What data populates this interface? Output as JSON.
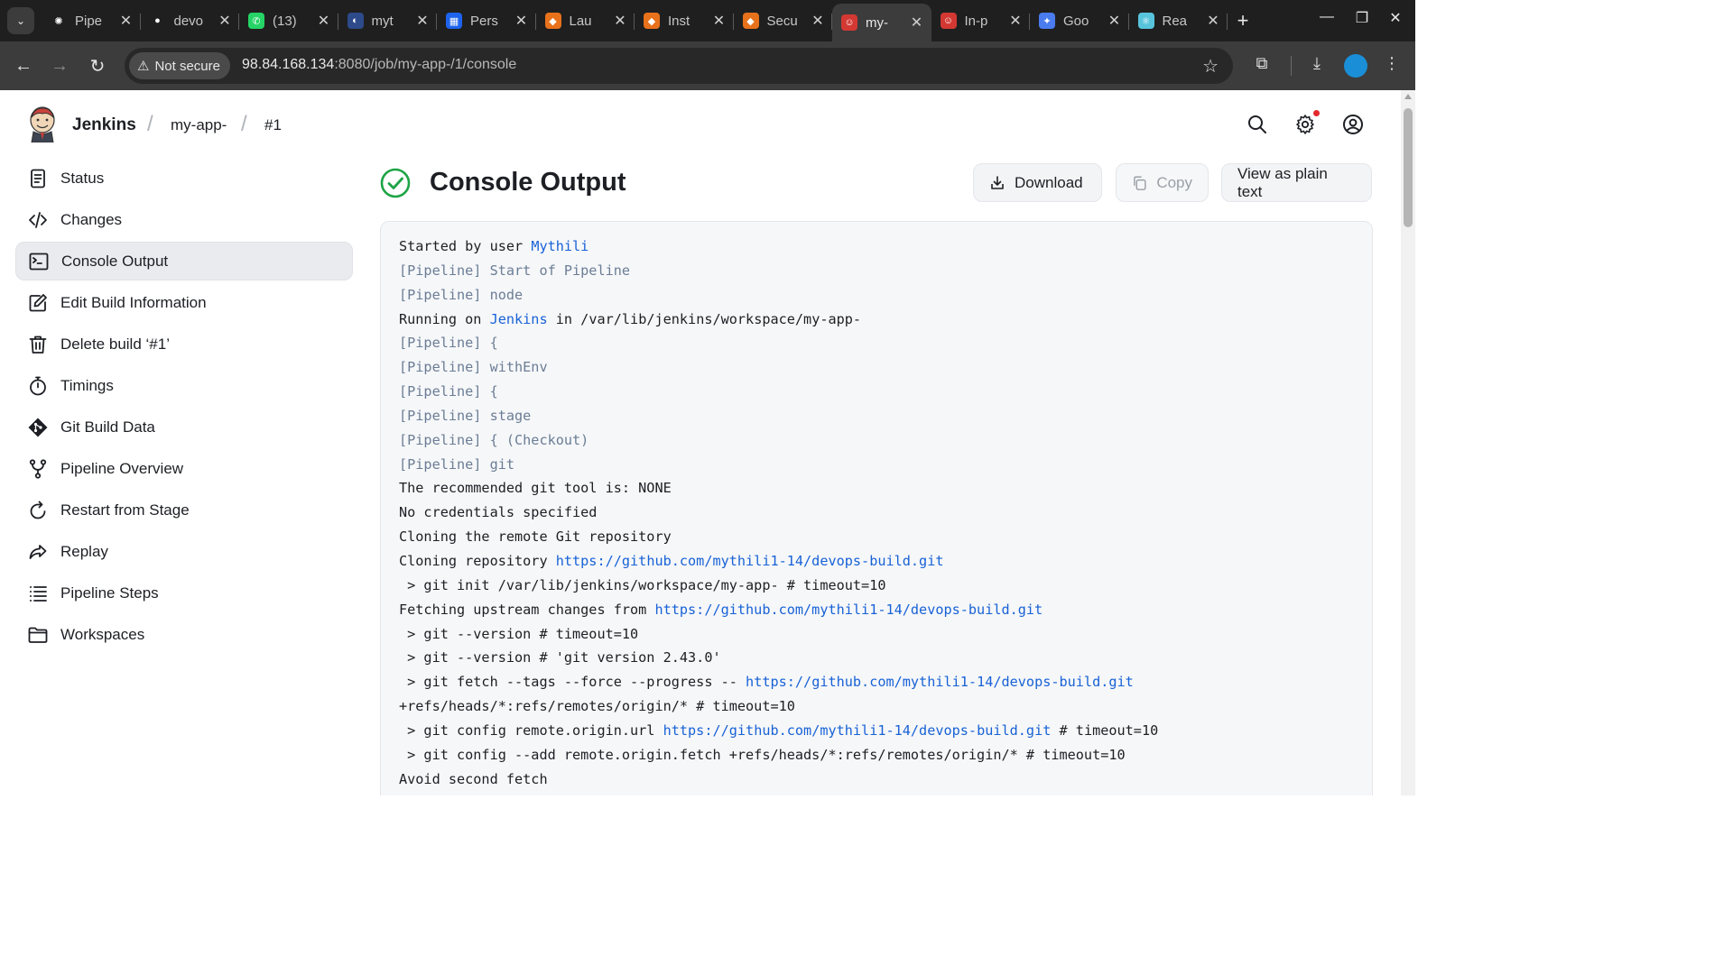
{
  "browser": {
    "tabs": [
      {
        "title": "Pipe",
        "icon": "openai-icon",
        "color": "#1f1f1f"
      },
      {
        "title": "devo",
        "icon": "github-icon",
        "color": "#1f1f1f"
      },
      {
        "title": "(13)",
        "icon": "whatsapp-icon",
        "color": "#25d366"
      },
      {
        "title": "myt",
        "icon": "app-icon",
        "color": "#2d4a8a"
      },
      {
        "title": "Pers",
        "icon": "docker-icon",
        "color": "#1d63ed"
      },
      {
        "title": "Lau",
        "icon": "aws-icon",
        "color": "#e8711b"
      },
      {
        "title": "Inst",
        "icon": "aws-icon",
        "color": "#e8711b"
      },
      {
        "title": "Secu",
        "icon": "aws-icon",
        "color": "#e8711b"
      },
      {
        "title": "my-",
        "icon": "jenkins-icon",
        "color": "#d33833",
        "active": true
      },
      {
        "title": "In-p",
        "icon": "jenkins-icon",
        "color": "#d33833"
      },
      {
        "title": "Goo",
        "icon": "gemini-icon",
        "color": "#4a7cf0"
      },
      {
        "title": "Rea",
        "icon": "react-icon",
        "color": "#58c4dc"
      }
    ],
    "security_label": "Not secure",
    "url_host": "98.84.168.134",
    "url_path": ":8080/job/my-app-/1/console"
  },
  "header": {
    "brand": "Jenkins",
    "crumbs": [
      "my-app-",
      "#1"
    ]
  },
  "sidebar": {
    "items": [
      {
        "label": "Status",
        "icon": "status-icon"
      },
      {
        "label": "Changes",
        "icon": "code-icon"
      },
      {
        "label": "Console Output",
        "icon": "terminal-icon",
        "active": true
      },
      {
        "label": "Edit Build Information",
        "icon": "edit-icon"
      },
      {
        "label": "Delete build ‘#1’",
        "icon": "trash-icon"
      },
      {
        "label": "Timings",
        "icon": "stopwatch-icon"
      },
      {
        "label": "Git Build Data",
        "icon": "git-icon"
      },
      {
        "label": "Pipeline Overview",
        "icon": "branch-icon"
      },
      {
        "label": "Restart from Stage",
        "icon": "restart-icon"
      },
      {
        "label": "Replay",
        "icon": "replay-icon"
      },
      {
        "label": "Pipeline Steps",
        "icon": "list-icon"
      },
      {
        "label": "Workspaces",
        "icon": "folder-icon"
      }
    ]
  },
  "main": {
    "title": "Console Output",
    "download_label": "Download",
    "copy_label": "Copy",
    "plain_label": "View as plain text"
  },
  "console": {
    "lines": [
      {
        "t": "plain",
        "parts": [
          [
            "Started by user ",
            ""
          ],
          [
            "Mythili",
            "link"
          ]
        ]
      },
      {
        "t": "pipeline",
        "parts": [
          [
            "[Pipeline] Start of Pipeline",
            ""
          ]
        ]
      },
      {
        "t": "pipeline",
        "parts": [
          [
            "[Pipeline] node",
            ""
          ]
        ]
      },
      {
        "t": "plain",
        "parts": [
          [
            "Running on ",
            ""
          ],
          [
            "Jenkins",
            "link"
          ],
          [
            " in /var/lib/jenkins/workspace/my-app-",
            ""
          ]
        ]
      },
      {
        "t": "pipeline",
        "parts": [
          [
            "[Pipeline] {",
            ""
          ]
        ]
      },
      {
        "t": "pipeline",
        "parts": [
          [
            "[Pipeline] withEnv",
            ""
          ]
        ]
      },
      {
        "t": "pipeline",
        "parts": [
          [
            "[Pipeline] {",
            ""
          ]
        ]
      },
      {
        "t": "pipeline",
        "parts": [
          [
            "[Pipeline] stage",
            ""
          ]
        ]
      },
      {
        "t": "pipeline",
        "parts": [
          [
            "[Pipeline] { (Checkout)",
            ""
          ]
        ]
      },
      {
        "t": "pipeline",
        "parts": [
          [
            "[Pipeline] git",
            ""
          ]
        ]
      },
      {
        "t": "plain",
        "parts": [
          [
            "The recommended git tool is: NONE",
            ""
          ]
        ]
      },
      {
        "t": "plain",
        "parts": [
          [
            "No credentials specified",
            ""
          ]
        ]
      },
      {
        "t": "plain",
        "parts": [
          [
            "Cloning the remote Git repository",
            ""
          ]
        ]
      },
      {
        "t": "plain",
        "parts": [
          [
            "Cloning repository ",
            ""
          ],
          [
            "https://github.com/mythili1-14/devops-build.git",
            "link"
          ]
        ]
      },
      {
        "t": "plain",
        "parts": [
          [
            " > git init /var/lib/jenkins/workspace/my-app- # timeout=10",
            ""
          ]
        ]
      },
      {
        "t": "plain",
        "parts": [
          [
            "Fetching upstream changes from ",
            ""
          ],
          [
            "https://github.com/mythili1-14/devops-build.git",
            "link"
          ]
        ]
      },
      {
        "t": "plain",
        "parts": [
          [
            " > git --version # timeout=10",
            ""
          ]
        ]
      },
      {
        "t": "plain",
        "parts": [
          [
            " > git --version # 'git version 2.43.0'",
            ""
          ]
        ]
      },
      {
        "t": "plain",
        "parts": [
          [
            " > git fetch --tags --force --progress -- ",
            ""
          ],
          [
            "https://github.com/mythili1-14/devops-build.git",
            "link"
          ]
        ]
      },
      {
        "t": "plain",
        "parts": [
          [
            "+refs/heads/*:refs/remotes/origin/* # timeout=10",
            ""
          ]
        ]
      },
      {
        "t": "plain",
        "parts": [
          [
            " > git config remote.origin.url ",
            ""
          ],
          [
            "https://github.com/mythili1-14/devops-build.git",
            "link"
          ],
          [
            " # timeout=10",
            ""
          ]
        ]
      },
      {
        "t": "plain",
        "parts": [
          [
            " > git config --add remote.origin.fetch +refs/heads/*:refs/remotes/origin/* # timeout=10",
            ""
          ]
        ]
      },
      {
        "t": "plain",
        "parts": [
          [
            "Avoid second fetch",
            ""
          ]
        ]
      }
    ]
  }
}
